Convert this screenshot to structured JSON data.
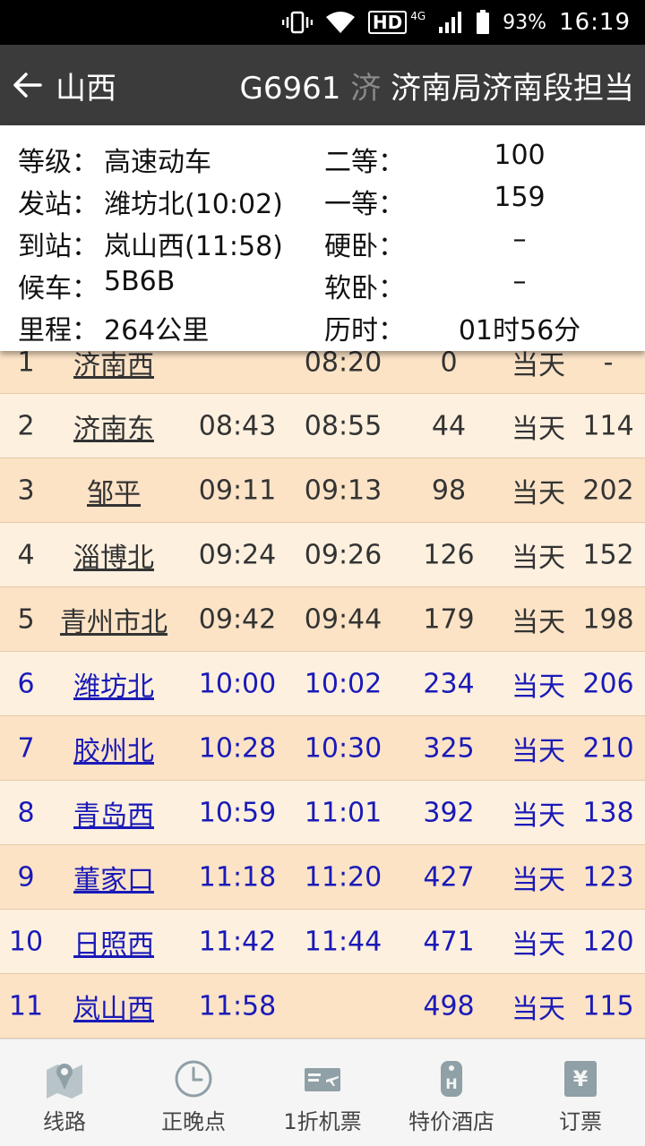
{
  "status_bar": {
    "hd": "HD",
    "net": "4G",
    "battery": "93%",
    "time": "16:19"
  },
  "title_bar": {
    "left": "山西",
    "right_main": "G6961 ",
    "right_fade": "济",
    "right_rest": " 济南局济南段担当"
  },
  "info": {
    "rows": [
      {
        "label": "等级：",
        "value": "高速动车",
        "label2": "二等：",
        "value2": "100"
      },
      {
        "label": "发站：",
        "value": "潍坊北(10:02)",
        "label2": "一等：",
        "value2": "159"
      },
      {
        "label": "到站：",
        "value": "岚山西(11:58)",
        "label2": "硬卧：",
        "value2": "–"
      },
      {
        "label": "候车：",
        "value": "5B6B",
        "label2": "软卧：",
        "value2": "–"
      },
      {
        "label": "里程：",
        "value": "264公里",
        "label2": "历时：",
        "value2": "01时56分"
      }
    ]
  },
  "stops": [
    {
      "no": "1",
      "station": "济南西",
      "arr": "",
      "dep": "08:20",
      "km": "0",
      "day": "当天",
      "speed": "-",
      "highlight": false
    },
    {
      "no": "2",
      "station": "济南东",
      "arr": "08:43",
      "dep": "08:55",
      "km": "44",
      "day": "当天",
      "speed": "114",
      "highlight": false
    },
    {
      "no": "3",
      "station": "邹平",
      "arr": "09:11",
      "dep": "09:13",
      "km": "98",
      "day": "当天",
      "speed": "202",
      "highlight": false
    },
    {
      "no": "4",
      "station": "淄博北",
      "arr": "09:24",
      "dep": "09:26",
      "km": "126",
      "day": "当天",
      "speed": "152",
      "highlight": false
    },
    {
      "no": "5",
      "station": "青州市北",
      "arr": "09:42",
      "dep": "09:44",
      "km": "179",
      "day": "当天",
      "speed": "198",
      "highlight": false
    },
    {
      "no": "6",
      "station": "潍坊北",
      "arr": "10:00",
      "dep": "10:02",
      "km": "234",
      "day": "当天",
      "speed": "206",
      "highlight": true
    },
    {
      "no": "7",
      "station": "胶州北",
      "arr": "10:28",
      "dep": "10:30",
      "km": "325",
      "day": "当天",
      "speed": "210",
      "highlight": true
    },
    {
      "no": "8",
      "station": "青岛西",
      "arr": "10:59",
      "dep": "11:01",
      "km": "392",
      "day": "当天",
      "speed": "138",
      "highlight": true
    },
    {
      "no": "9",
      "station": "董家口",
      "arr": "11:18",
      "dep": "11:20",
      "km": "427",
      "day": "当天",
      "speed": "123",
      "highlight": true
    },
    {
      "no": "10",
      "station": "日照西",
      "arr": "11:42",
      "dep": "11:44",
      "km": "471",
      "day": "当天",
      "speed": "120",
      "highlight": true
    },
    {
      "no": "11",
      "station": "岚山西",
      "arr": "11:58",
      "dep": "",
      "km": "498",
      "day": "当天",
      "speed": "115",
      "highlight": true
    }
  ],
  "bottom_nav": [
    {
      "label": "线路",
      "icon": "map-route-icon"
    },
    {
      "label": "正晚点",
      "icon": "clock-icon"
    },
    {
      "label": "1折机票",
      "icon": "plane-ticket-icon"
    },
    {
      "label": "特价酒店",
      "icon": "hotel-tag-icon"
    },
    {
      "label": "订票",
      "icon": "yen-ticket-icon"
    }
  ],
  "colors": {
    "highlight": "#1a1ab8",
    "row_odd": "#fce3c6",
    "row_even": "#fdf0df",
    "title_bg": "#3b3b3b"
  }
}
